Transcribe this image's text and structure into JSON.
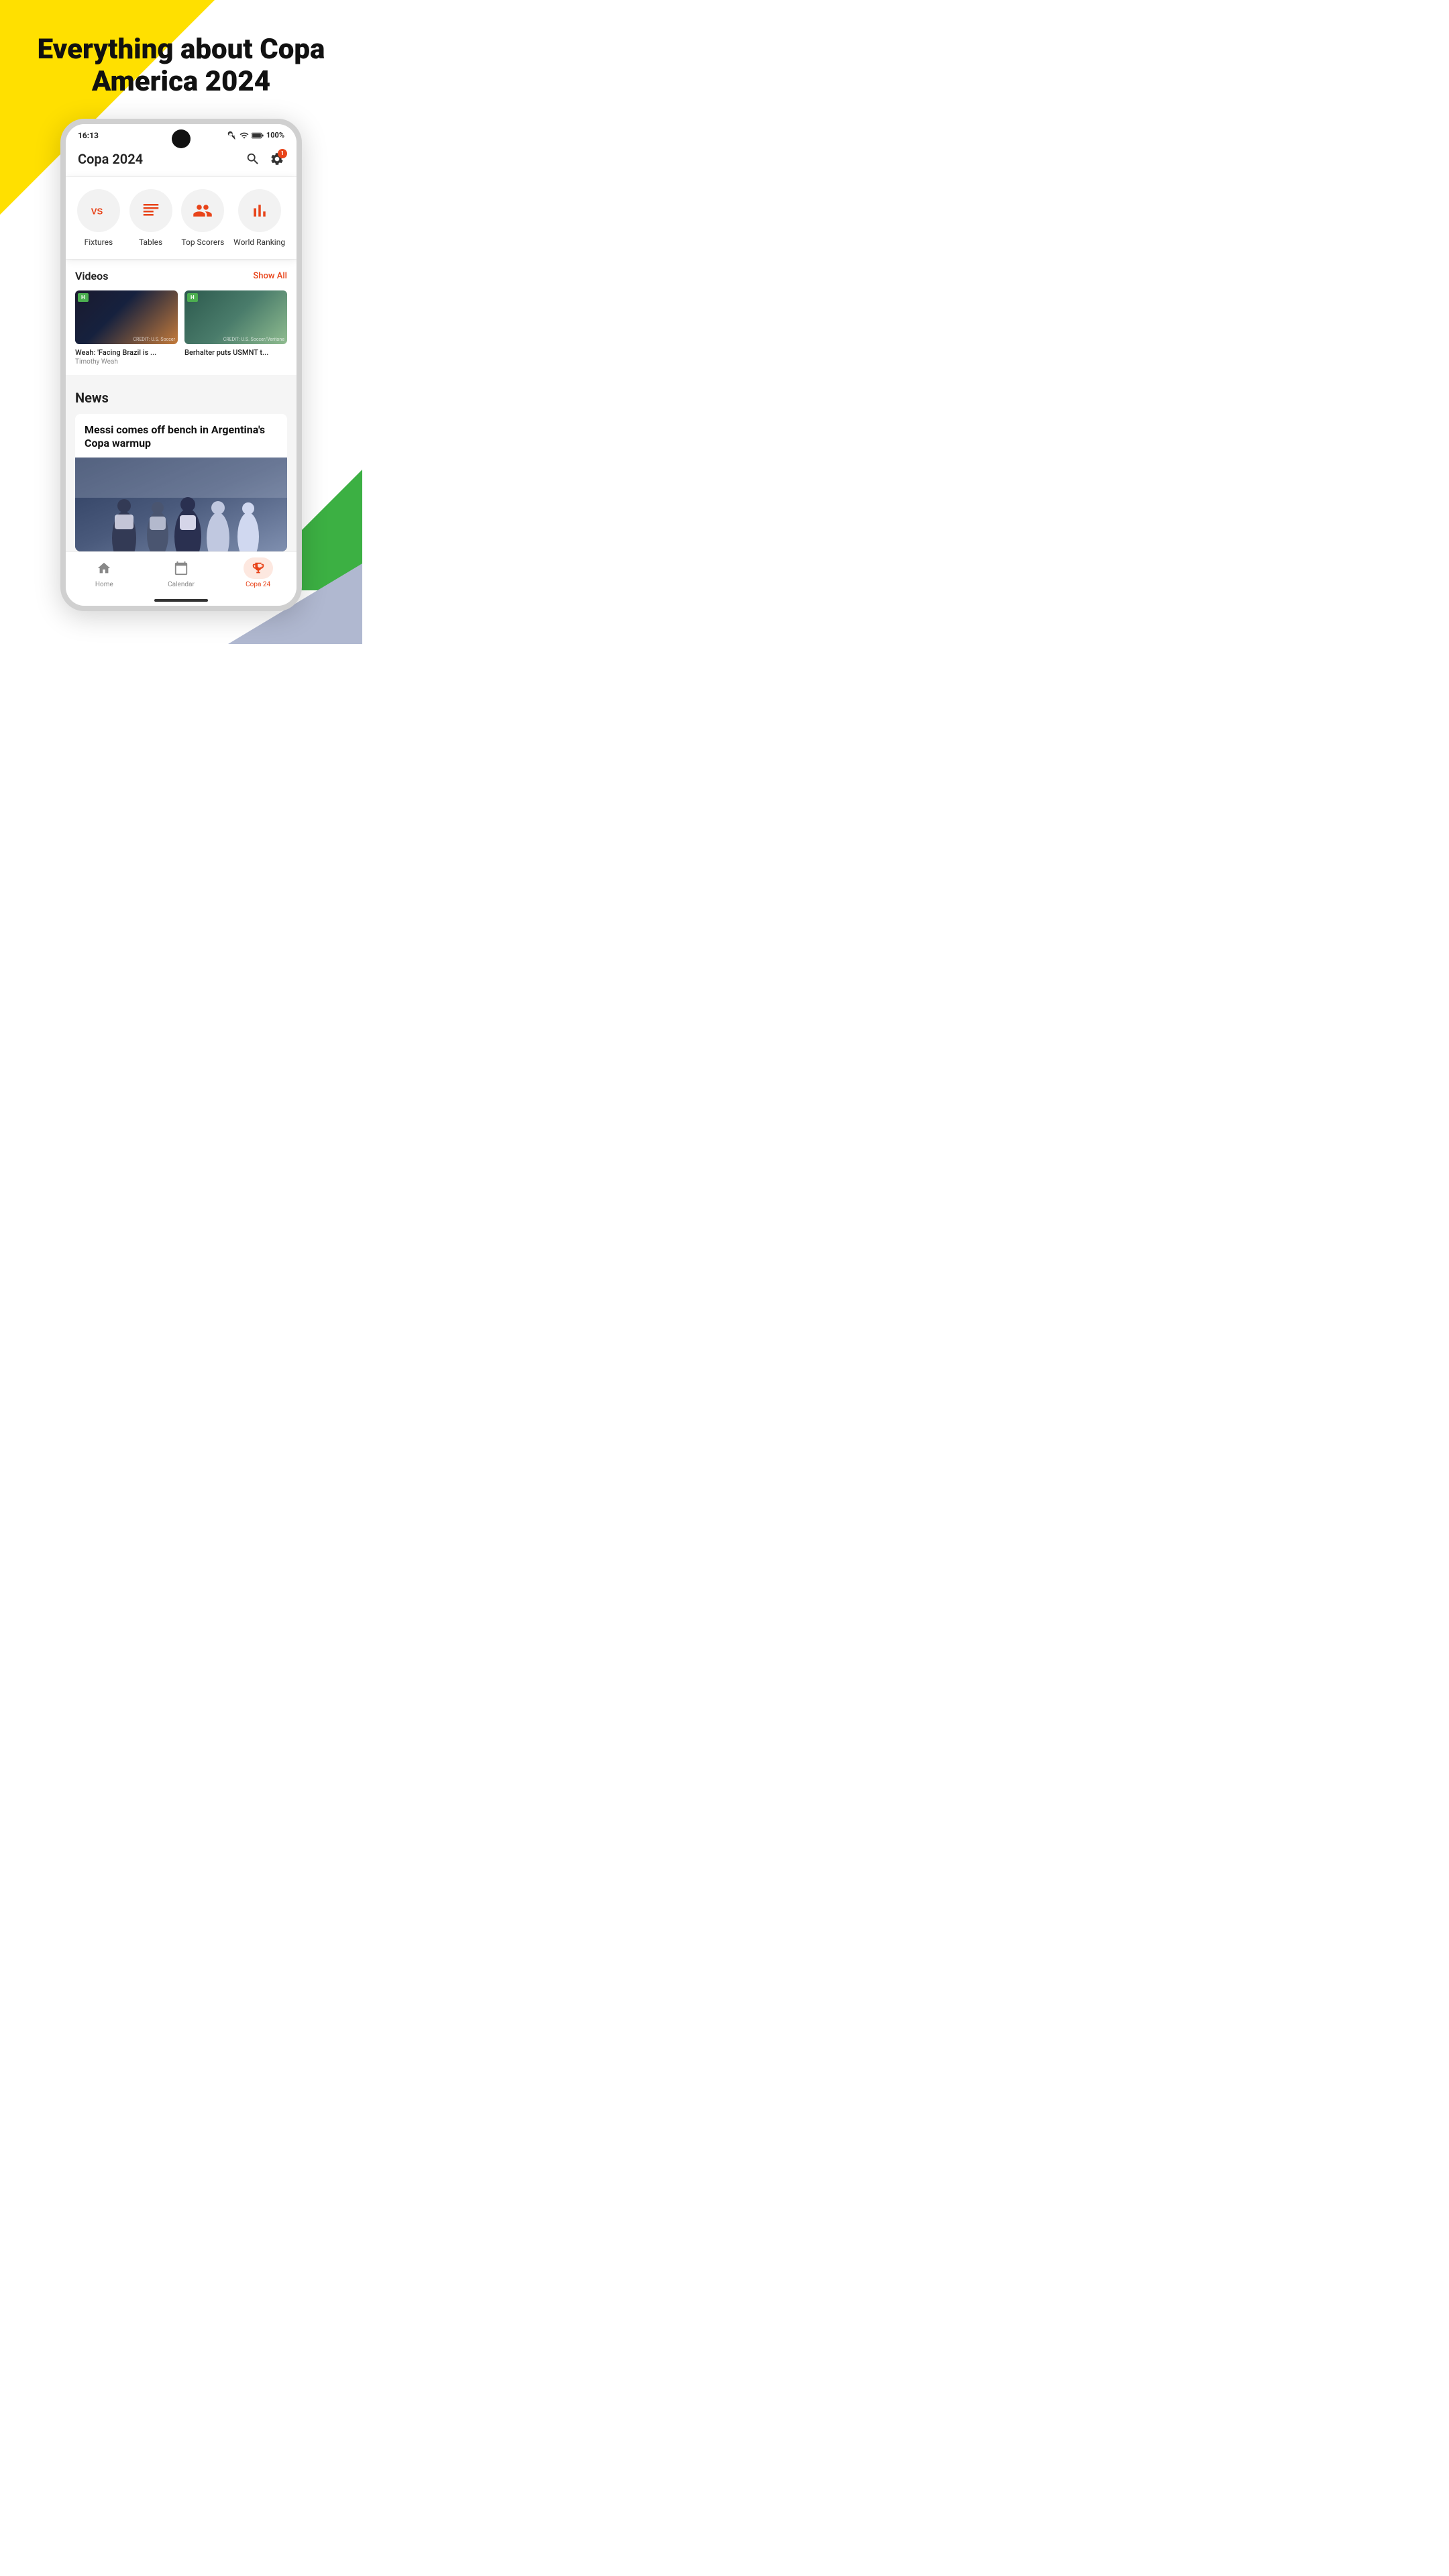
{
  "hero": {
    "title": "Everything about Copa America 2024"
  },
  "status_bar": {
    "time": "16:13",
    "battery": "100%"
  },
  "app_header": {
    "title": "Copa 2024",
    "notification_count": "1"
  },
  "nav_menu": {
    "items": [
      {
        "id": "fixtures",
        "label": "Fixtures",
        "icon": "vs-icon"
      },
      {
        "id": "tables",
        "label": "Tables",
        "icon": "tables-icon"
      },
      {
        "id": "top-scorers",
        "label": "Top Scorers",
        "icon": "scorers-icon"
      },
      {
        "id": "world-ranking",
        "label": "World Ranking",
        "icon": "ranking-icon"
      }
    ]
  },
  "videos": {
    "section_title": "Videos",
    "show_all_label": "Show All",
    "items": [
      {
        "title": "Weah: 'Facing Brazil is ...",
        "subtitle": "Timothy Weah",
        "badge": "H",
        "credit": "CREDIT: U.S. Soccer"
      },
      {
        "title": "Berhalter puts USMNT t...",
        "subtitle": "",
        "badge": "H",
        "credit": "CREDIT: U.S. Soccer/Veritone"
      }
    ]
  },
  "news": {
    "section_title": "News",
    "featured": {
      "headline": "Messi comes off bench in Argentina's Copa warmup"
    }
  },
  "bottom_nav": {
    "items": [
      {
        "id": "home",
        "label": "Home",
        "icon": "home-icon",
        "active": false
      },
      {
        "id": "calendar",
        "label": "Calendar",
        "icon": "calendar-icon",
        "active": false
      },
      {
        "id": "copa24",
        "label": "Copa 24",
        "icon": "trophy-icon",
        "active": true
      }
    ]
  }
}
